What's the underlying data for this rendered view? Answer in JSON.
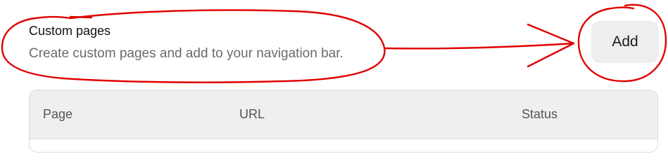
{
  "section": {
    "title": "Custom pages",
    "description": "Create custom pages and add to your navigation bar."
  },
  "actions": {
    "add_label": "Add"
  },
  "table": {
    "columns": [
      "Page",
      "URL",
      "Status"
    ]
  },
  "colors": {
    "annotation": "#e00000",
    "button_bg": "#eeeeee",
    "header_bg": "#efefef",
    "muted_text": "#6b6b6b"
  },
  "annotations": {
    "icon": "red-hand-drawn-circles-and-arrow"
  }
}
